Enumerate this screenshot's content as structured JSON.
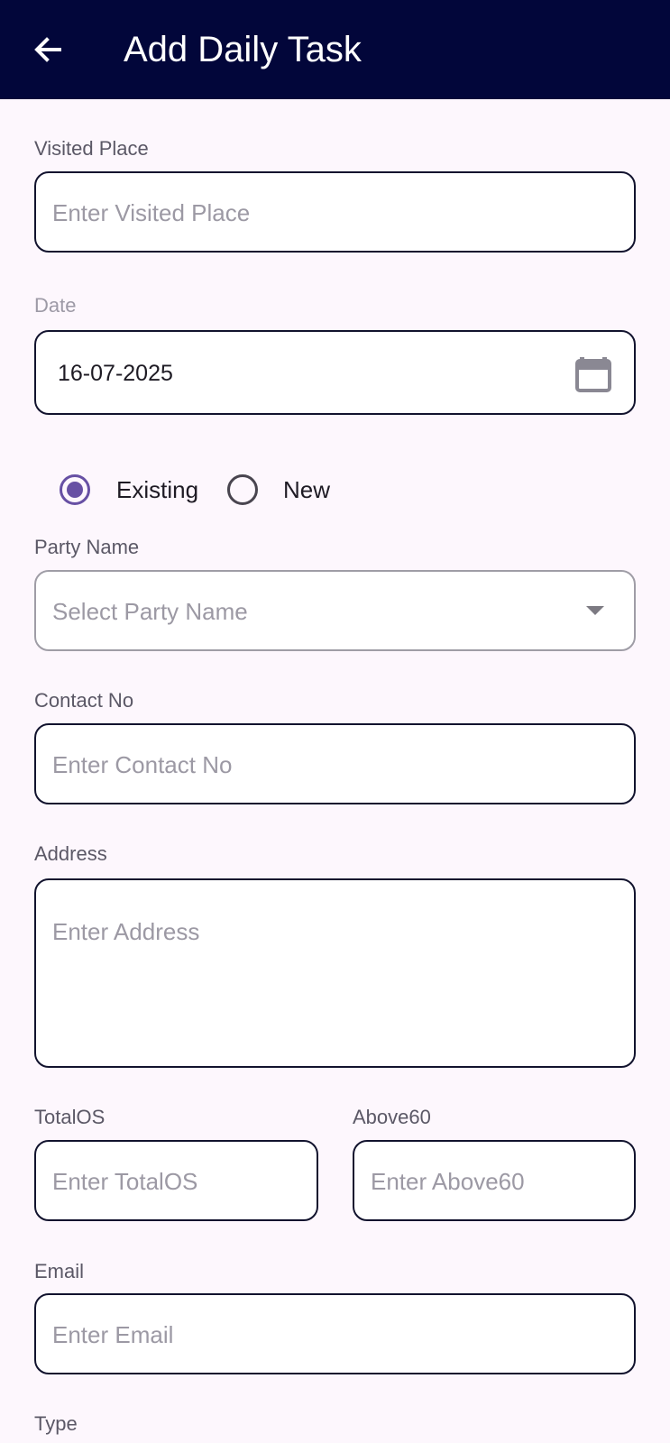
{
  "app_bar": {
    "title": "Add Daily Task",
    "back_icon": "arrow-left-icon",
    "background": "#02063a"
  },
  "form": {
    "visited_place": {
      "label": "Visited Place",
      "placeholder": "Enter Visited Place",
      "value": ""
    },
    "date": {
      "label": "Date",
      "value": "16-07-2025",
      "icon": "calendar-icon"
    },
    "customer_type": {
      "options": [
        {
          "label": "Existing",
          "selected": true
        },
        {
          "label": "New",
          "selected": false
        }
      ],
      "accent": "#6750a4"
    },
    "party_name": {
      "label": "Party Name",
      "placeholder": "Select Party Name",
      "icon": "dropdown-arrow-icon"
    },
    "contact_no": {
      "label": "Contact No",
      "placeholder": "Enter Contact No",
      "value": ""
    },
    "address": {
      "label": "Address",
      "placeholder": "Enter Address",
      "value": ""
    },
    "total_os": {
      "label": "TotalOS",
      "placeholder": "Enter TotalOS",
      "value": ""
    },
    "above60": {
      "label": "Above60",
      "placeholder": "Enter Above60",
      "value": ""
    },
    "email": {
      "label": "Email",
      "placeholder": "Enter Email",
      "value": ""
    },
    "type": {
      "label": "Type"
    }
  }
}
